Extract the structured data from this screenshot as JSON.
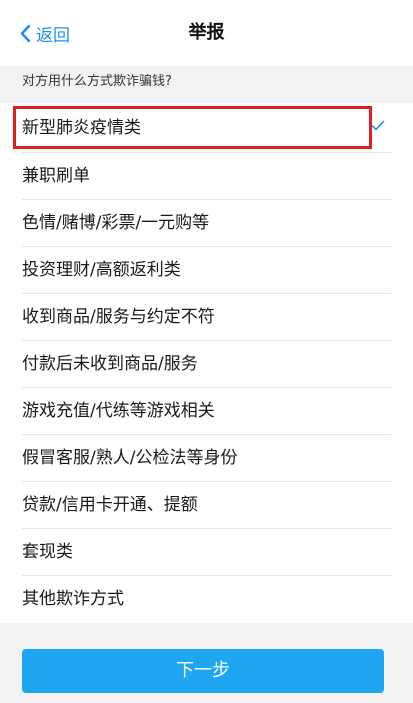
{
  "header": {
    "back_label": "返回",
    "title": "举报"
  },
  "question": "对方用什么方式欺诈骗钱?",
  "options": [
    {
      "label": "新型肺炎疫情类",
      "selected": true
    },
    {
      "label": "兼职刷单",
      "selected": false
    },
    {
      "label": "色情/赌博/彩票/一元购等",
      "selected": false
    },
    {
      "label": "投资理财/高额返利类",
      "selected": false
    },
    {
      "label": "收到商品/服务与约定不符",
      "selected": false
    },
    {
      "label": "付款后未收到商品/服务",
      "selected": false
    },
    {
      "label": "游戏充值/代练等游戏相关",
      "selected": false
    },
    {
      "label": "假冒客服/熟人/公检法等身份",
      "selected": false
    },
    {
      "label": "贷款/信用卡开通、提额",
      "selected": false
    },
    {
      "label": "套现类",
      "selected": false
    },
    {
      "label": "其他欺诈方式",
      "selected": false
    }
  ],
  "footer": {
    "next_label": "下一步"
  },
  "colors": {
    "accent": "#1a8ff0",
    "button": "#1fa6f0",
    "highlight": "#e02020"
  }
}
